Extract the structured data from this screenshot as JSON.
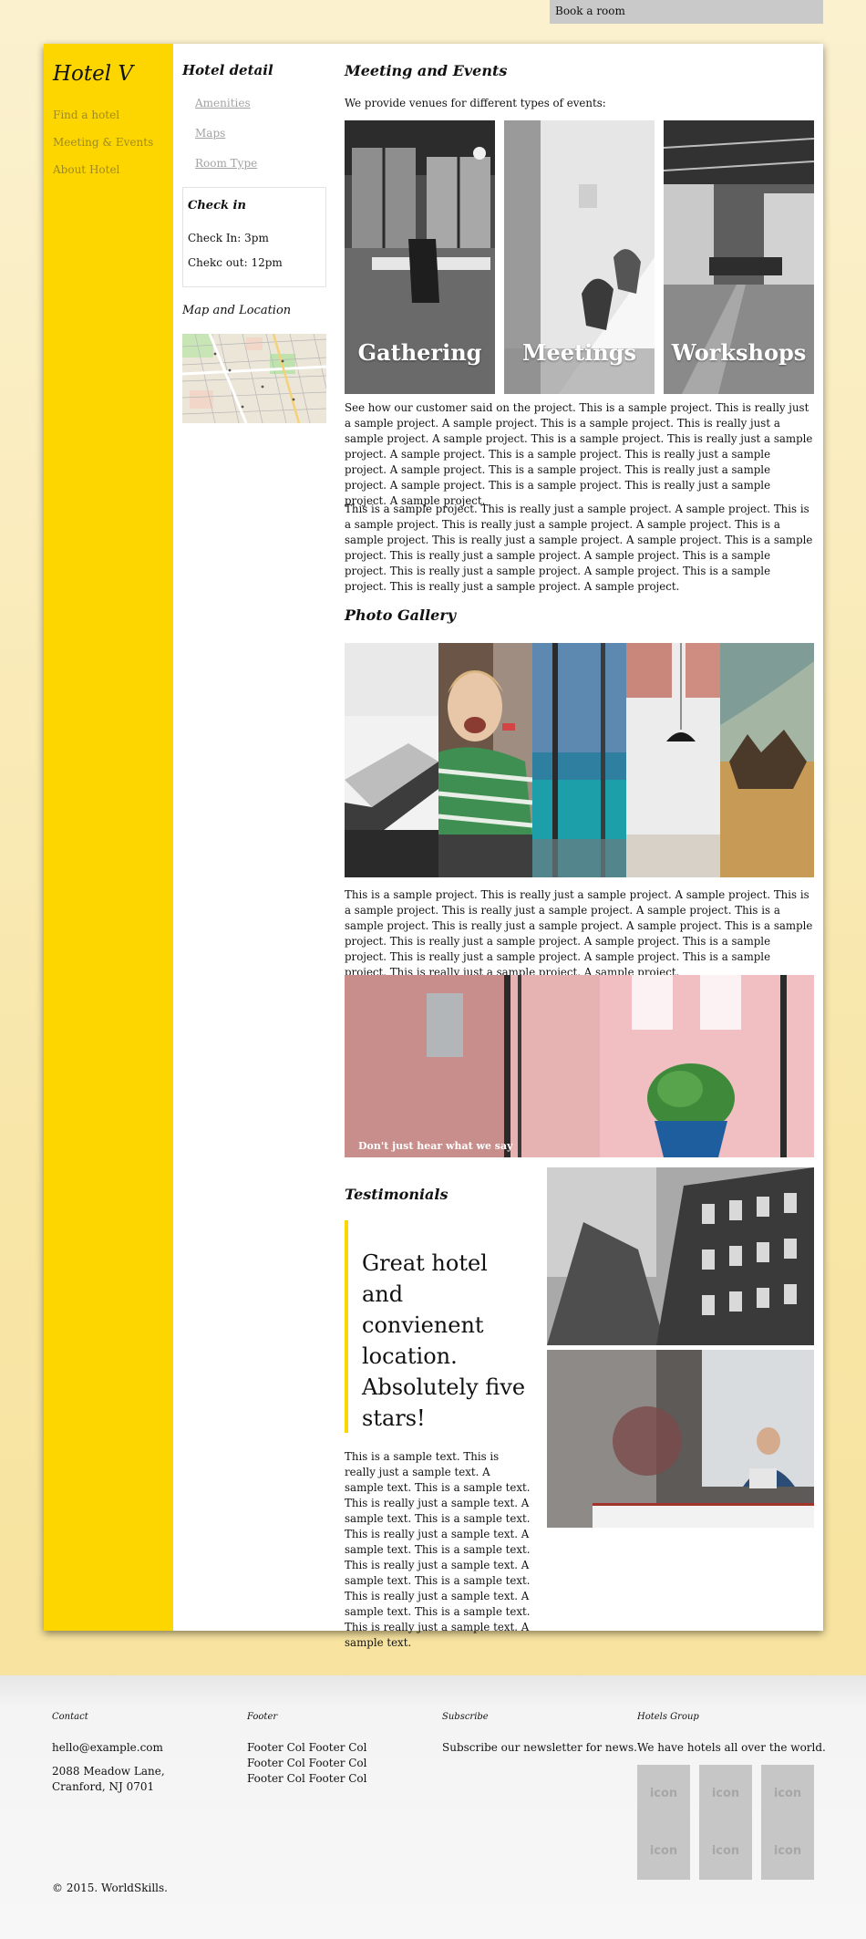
{
  "topbar": {
    "book": "Book a room"
  },
  "sidebar": {
    "logo": "Hotel V",
    "nav": [
      "Find a hotel",
      "Meeting & Events",
      "About Hotel"
    ]
  },
  "detail": {
    "title": "Hotel detail",
    "subnav": [
      "Amenities",
      "Maps",
      "Room Type"
    ],
    "checkin": {
      "title": "Check in",
      "in": "Check In: 3pm",
      "out": "Chekc out: 12pm"
    },
    "map_title": "Map and Location"
  },
  "main": {
    "title": "Meeting and Events",
    "intro": "We provide venues for different types of events:",
    "events": [
      "Gathering",
      "Meetings",
      "Workshops"
    ],
    "p1": "See how our customer said on the project. This is a sample project. This is really just a sample project. A sample project. This is a sample project. This is really just a sample project. A sample project. This is a sample project. This is really just a sample project. A sample project. This is a sample project. This is really just a sample project. A sample project. This is a sample project. This is really just a sample project. A sample project. This is a sample project. This is really just a sample project. A sample project.",
    "p2": "This is a sample project. This is really just a sample project. A sample project. This is a sample project. This is really just a sample project. A sample project. This is a sample project. This is really just a sample project. A sample project. This is a sample project. This is really just a sample project. A sample project. This is a sample project. This is really just a sample project. A sample project. This is a sample project. This is really just a sample project. A sample project.",
    "gallery_title": "Photo Gallery",
    "p3": "This is a sample project. This is really just a sample project. A sample project. This is a sample project. This is really just a sample project. A sample project. This is a sample project. This is really just a sample project. A sample project. This is a sample project. This is really just a sample project. A sample project. This is a sample project. This is really just a sample project. A sample project. This is a sample project. This is really just a sample project. A sample project.",
    "banner_caption": "Don't just hear what we say",
    "testimonials_title": "Testimonials",
    "quote": "Great hotel and convienent location. Absolutely five stars!",
    "p4": "This is a sample text. This is really just a sample text. A sample text. This is a sample text. This is really just a sample text. A sample text. This is a sample text. This is really just a sample text. A sample text. This is a sample text. This is really just a sample text. A sample text. This is a sample text. This is really just a sample text. A sample text. This is a sample text. This is really just a sample text. A sample text."
  },
  "footer": {
    "contact": {
      "title": "Contact",
      "email": "hello@example.com",
      "addr1": "2088 Meadow Lane,",
      "addr2": "Cranford, NJ 0701"
    },
    "footer": {
      "title": "Footer",
      "text": "Footer Col Footer Col Footer Col Footer Col Footer Col Footer Col"
    },
    "subscribe": {
      "title": "Subscribe",
      "text": "Subscribe our newsletter for news."
    },
    "group": {
      "title": "Hotels Group",
      "text": "We have hotels all over the world.",
      "icon_label": "icon"
    },
    "copyright": "© 2015. WorldSkills."
  },
  "colors": {
    "accent": "#fdd600",
    "background": "#f8e6a8"
  }
}
